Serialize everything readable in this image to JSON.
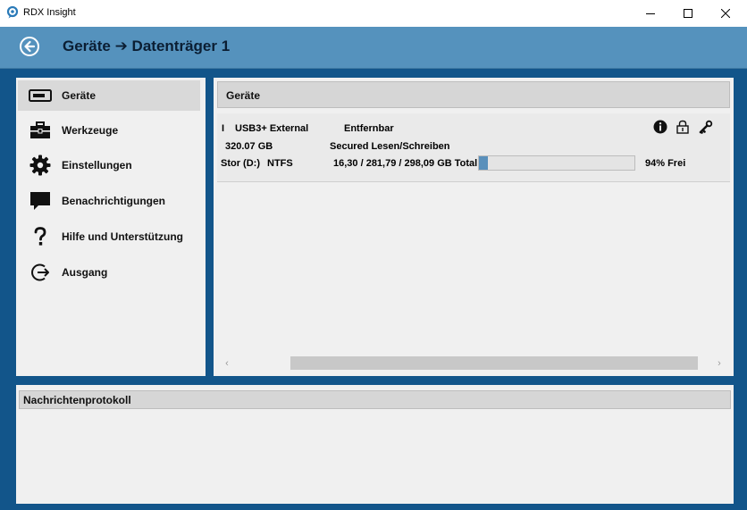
{
  "window": {
    "title": "RDX Insight",
    "minimize_label": "minimize",
    "maximize_label": "maximize",
    "close_label": "close"
  },
  "header": {
    "title": "Geräte ➔ Datenträger 1"
  },
  "sidebar": {
    "items": [
      {
        "label": "Geräte",
        "icon": "drive-icon",
        "active": true
      },
      {
        "label": "Werkzeuge",
        "icon": "toolbox-icon"
      },
      {
        "label": "Einstellungen",
        "icon": "gear-icon"
      },
      {
        "label": "Benachrichtigungen",
        "icon": "speech-bubble-icon"
      },
      {
        "label": "Hilfe und Unterstützung",
        "icon": "question-mark-icon"
      },
      {
        "label": "Ausgang",
        "icon": "exit-icon"
      }
    ]
  },
  "devices_panel": {
    "title": "Geräte",
    "device": {
      "marker": "I",
      "name": "USB3+ External",
      "type": "Entfernbar",
      "capacity": "320.07 GB",
      "status": "Secured Lesen/Schreiben",
      "volume": "Stor (D:)",
      "filesystem": "NTFS",
      "usage": "16,30 / 281,79 / 298,09 GB Total",
      "used_fraction": 0.06,
      "free": "94% Frei"
    },
    "scroll_left": "‹",
    "scroll_right": "›"
  },
  "log_panel": {
    "title": "Nachrichtenprotokoll"
  },
  "colors": {
    "header_bg": "#5592bd",
    "frame_bg": "#12558a",
    "panel_bg": "#f0f0f0",
    "progress_fill": "#5a90bb"
  }
}
